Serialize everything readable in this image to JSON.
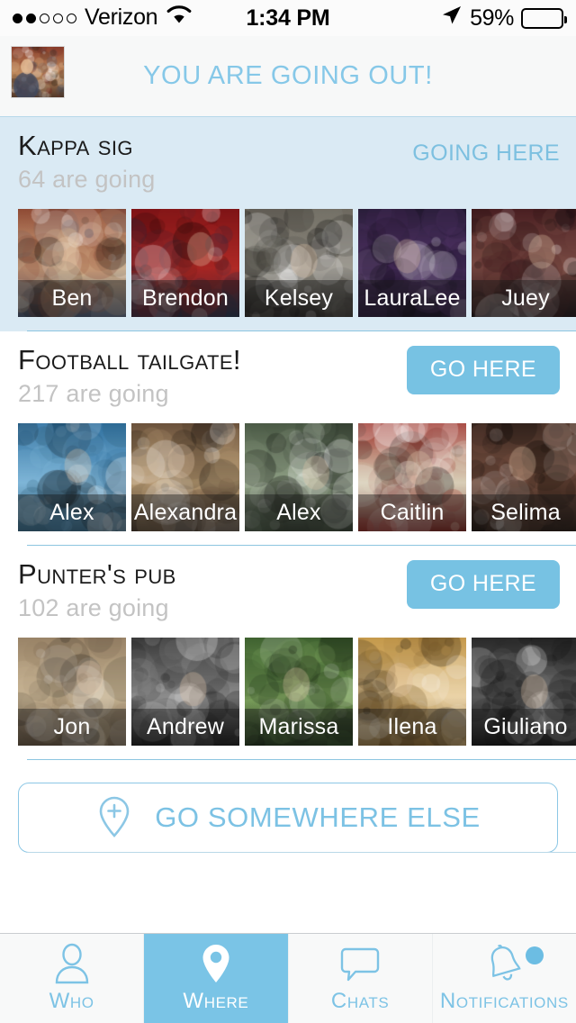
{
  "status_bar": {
    "carrier": "Verizon",
    "signal_dots_filled": 2,
    "signal_dots_total": 5,
    "wifi_icon": "wifi-icon",
    "time": "1:34 PM",
    "location_icon": "location-arrow-icon",
    "battery_percent": "59%",
    "battery_level": 59
  },
  "header": {
    "avatar_icon": "user-avatar-photo",
    "title": "YOU ARE GOING OUT!",
    "accent_color": "#86c8e8"
  },
  "events": [
    {
      "name": "Kappa Sig",
      "going_count": "64 are going",
      "action_label": "GOING HERE",
      "action_style": "text",
      "selected": true,
      "attendees": [
        {
          "name": "Ben"
        },
        {
          "name": "Brendon"
        },
        {
          "name": "Kelsey"
        },
        {
          "name": "LauraLee"
        },
        {
          "name": "Juey"
        }
      ]
    },
    {
      "name": "Football Tailgate!",
      "going_count": "217 are going",
      "action_label": "GO HERE",
      "action_style": "button",
      "selected": false,
      "attendees": [
        {
          "name": "Alex"
        },
        {
          "name": "Alexandra"
        },
        {
          "name": "Alex"
        },
        {
          "name": "Caitlin"
        },
        {
          "name": "Selima"
        }
      ]
    },
    {
      "name": "Punter's Pub",
      "going_count": "102 are going",
      "action_label": "GO HERE",
      "action_style": "button",
      "selected": false,
      "attendees": [
        {
          "name": "Jon"
        },
        {
          "name": "Andrew"
        },
        {
          "name": "Marissa"
        },
        {
          "name": "Ilena"
        },
        {
          "name": "Giuliano"
        }
      ]
    }
  ],
  "go_somewhere_else": {
    "label": "GO SOMEWHERE ELSE",
    "icon": "map-pin-plus-icon"
  },
  "tab_bar": {
    "tabs": [
      {
        "label": "Who",
        "icon": "person-icon",
        "active": false,
        "badge": false
      },
      {
        "label": "Where",
        "icon": "map-pin-icon",
        "active": true,
        "badge": false
      },
      {
        "label": "Chats",
        "icon": "speech-bubble-icon",
        "active": false,
        "badge": false
      },
      {
        "label": "Notifications",
        "icon": "bell-icon",
        "active": false,
        "badge": true
      }
    ],
    "active_color": "#7ac4e6",
    "inactive_color": "#7dc3e5"
  },
  "theme": {
    "accent": "#7ac4e6",
    "selected_card_bg": "#daeaf4",
    "button_blue": "#77c2e3",
    "muted_text": "#c3c3c3"
  }
}
